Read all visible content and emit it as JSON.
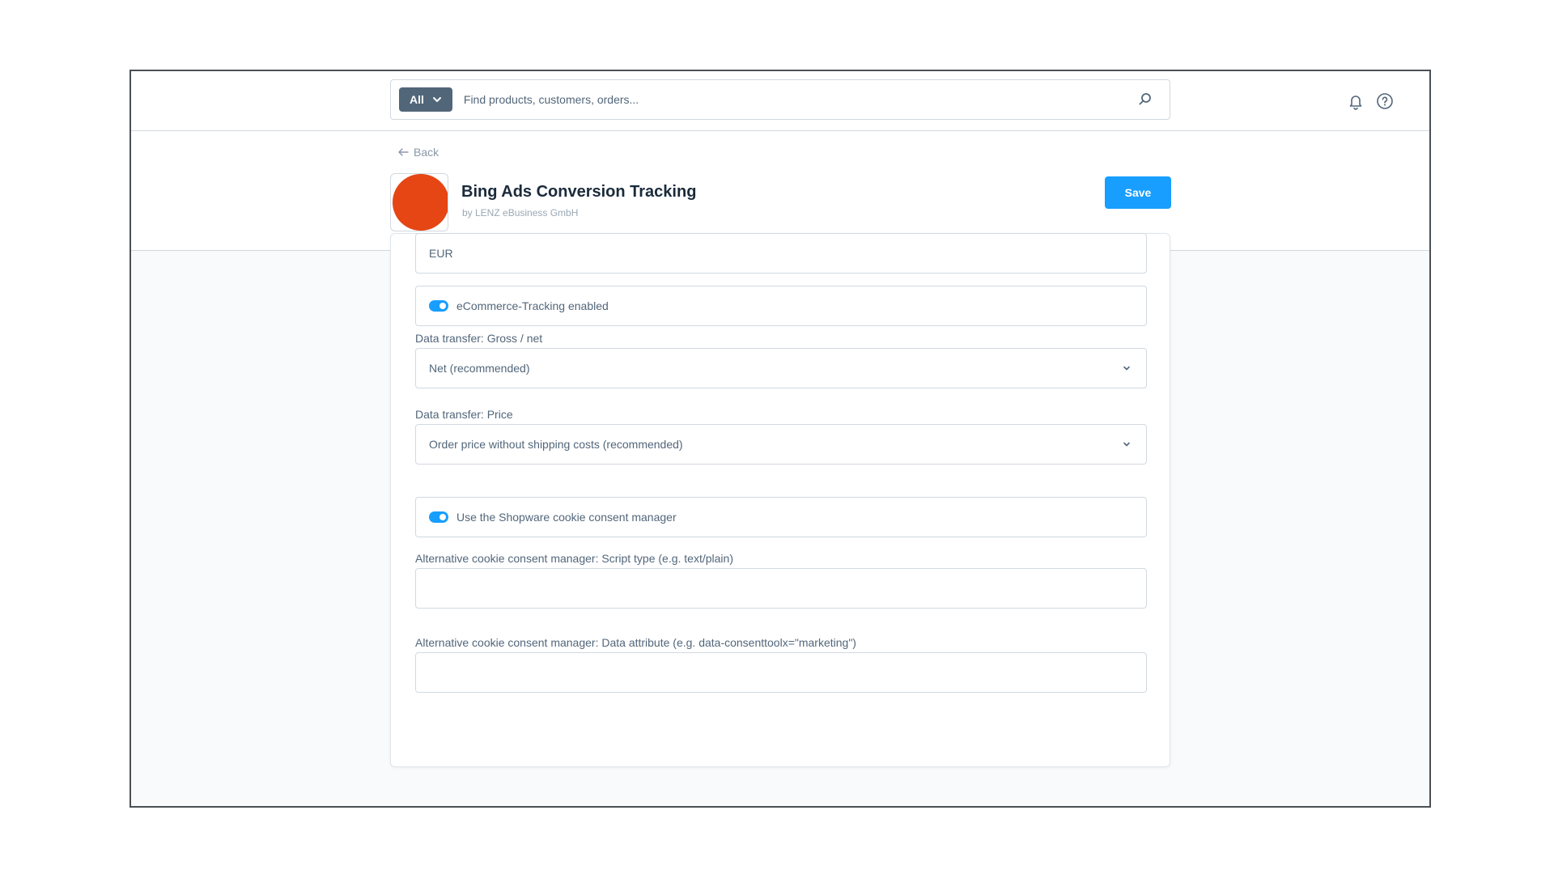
{
  "topbar": {
    "type_selector_label": "All",
    "search_placeholder": "Find products, customers, orders..."
  },
  "header": {
    "back_label": "Back",
    "title": "Bing Ads Conversion Tracking",
    "vendor": "by LENZ eBusiness GmbH",
    "save_label": "Save",
    "logo_color": "#e54614"
  },
  "form": {
    "currency_value": "EUR",
    "ecommerce_toggle": {
      "label": "eCommerce-Tracking enabled",
      "enabled": true
    },
    "gross_net": {
      "label": "Data transfer: Gross / net",
      "value": "Net (recommended)"
    },
    "price": {
      "label": "Data transfer: Price",
      "value": "Order price without shipping costs (recommended)"
    },
    "cookie_toggle": {
      "label": "Use the Shopware cookie consent manager",
      "enabled": true
    },
    "script_type": {
      "label": "Alternative cookie consent manager: Script type (e.g. text/plain)",
      "value": ""
    },
    "data_attribute": {
      "label": "Alternative cookie consent manager: Data attribute (e.g. data-consenttoolx=\"marketing\")",
      "value": ""
    }
  },
  "colors": {
    "accent": "#189eff",
    "type_button": "#52667a"
  }
}
